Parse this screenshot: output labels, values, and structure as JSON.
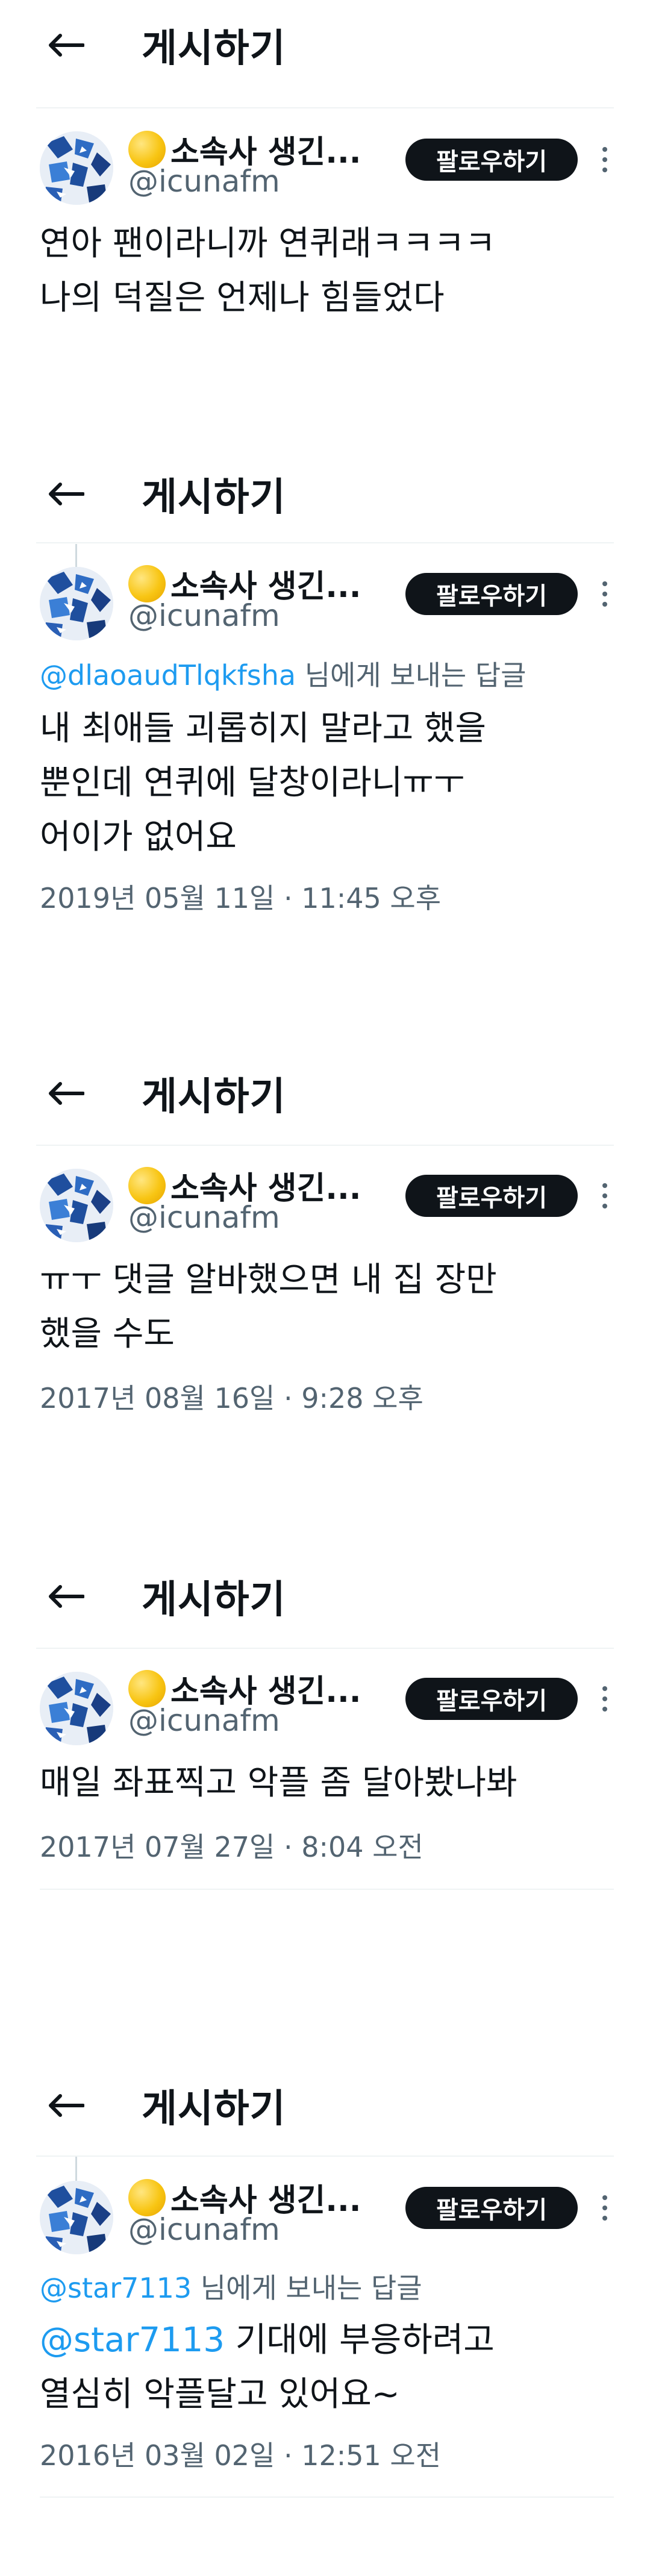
{
  "colors": {
    "mention": "#1d9bf0",
    "text": "#0f1419",
    "secondary": "#536471",
    "button": "#0f1419"
  },
  "header_title": "게시하기",
  "author": {
    "name": "소속사 생긴...",
    "handle": "@icunafm",
    "follow_label": "팔로우하기"
  },
  "reply_suffix": " 님에게 보내는 답글",
  "posts": [
    {
      "text_lines": [
        "연아 팬이라니까 연퀴래ㅋㅋㅋㅋ",
        "나의 덕질은 언제나 힘들었다"
      ]
    },
    {
      "reply_to": "@dlaoaudTlqkfsha",
      "text_lines": [
        "내 최애들 괴롭히지 말라고 했을",
        "뿐인데 연퀴에 달창이라니ㅠㅜ",
        "어이가 없어요"
      ],
      "timestamp": "2019년 05월 11일 · 11:45 오후"
    },
    {
      "text_lines": [
        "ㅠㅜ 댓글 알바했으면 내 집 장만",
        "했을 수도"
      ],
      "timestamp": "2017년 08월 16일 · 9:28 오후"
    },
    {
      "text_lines": [
        "매일 좌표찍고 악플 좀 달아봤나봐"
      ],
      "timestamp": "2017년 07월 27일 · 8:04 오전"
    },
    {
      "reply_to": "@star7113",
      "text_mention": "@star7113",
      "text_lines": [
        " 기대에 부응하려고",
        "열심히 악플달고 있어요~"
      ],
      "timestamp": "2016년 03월 02일 · 12:51 오전"
    }
  ]
}
